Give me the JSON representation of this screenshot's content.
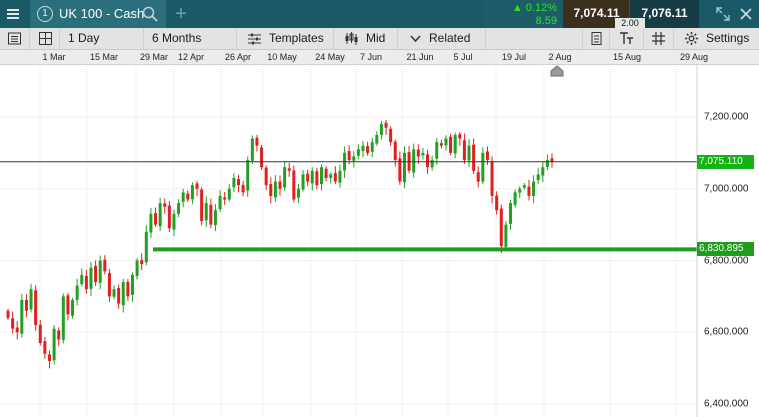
{
  "header": {
    "tab_number": "1",
    "market_title": "UK 100 - Cash",
    "add_tab": "+",
    "change_percent": "0.12%",
    "change_points": "8.59",
    "sell_price": "7,074.11",
    "buy_price": "7,076.11",
    "spread": "2.00",
    "colors": {
      "bar": "#1a5a67",
      "positive": "#2fe02f",
      "sell_bg": "#3b2f1d",
      "buy_bg": "#163c45"
    }
  },
  "toolbar": {
    "interval": "1 Day",
    "range": "6 Months",
    "templates": "Templates",
    "price_type": "Mid",
    "related": "Related",
    "settings": "Settings"
  },
  "date_axis": {
    "labels": [
      "1 Mar",
      "15 Mar",
      "29 Mar",
      "12 Apr",
      "26 Apr",
      "10 May",
      "24 May",
      "7 Jun",
      "21 Jun",
      "5 Jul",
      "19 Jul",
      "2 Aug",
      "15 Aug",
      "29 Aug"
    ]
  },
  "price_axis": {
    "labels": [
      "7,200.000",
      "7,000.000",
      "6,800.000",
      "6,600.000",
      "6,400.000"
    ],
    "current_price_label": "7,075.110",
    "support_label": "6,830.895"
  },
  "chart_data": {
    "type": "candlestick",
    "instrument": "UK 100 - Cash",
    "interval": "1 Day",
    "range": "6 Months",
    "ylim": [
      6390,
      7290
    ],
    "yticks": [
      7200,
      7000,
      6800,
      6600,
      6400
    ],
    "xticks": [
      "1 Mar",
      "15 Mar",
      "29 Mar",
      "12 Apr",
      "26 Apr",
      "10 May",
      "24 May",
      "7 Jun",
      "21 Jun",
      "5 Jul",
      "19 Jul",
      "2 Aug",
      "15 Aug",
      "29 Aug"
    ],
    "current_price": 7075.11,
    "horizontal_lines": [
      {
        "label": "6,830.895",
        "value": 6830.9,
        "color": "#1e9d1e"
      },
      {
        "label": "7,075.110",
        "value": 7075.11,
        "color": "#333333"
      }
    ],
    "up_color": "#22a022",
    "down_color": "#e02020",
    "closes": [
      6640,
      6610,
      6600,
      6690,
      6660,
      6720,
      6620,
      6570,
      6540,
      6520,
      6610,
      6580,
      6700,
      6650,
      6690,
      6730,
      6760,
      6720,
      6780,
      6740,
      6800,
      6770,
      6700,
      6720,
      6680,
      6740,
      6700,
      6760,
      6800,
      6790,
      6880,
      6930,
      6900,
      6960,
      6950,
      6890,
      6930,
      6960,
      6990,
      6970,
      7010,
      7000,
      6910,
      6960,
      6900,
      6940,
      6980,
      6970,
      7000,
      7030,
      7010,
      6990,
      7080,
      7140,
      7120,
      7060,
      7010,
      6980,
      7020,
      7000,
      7060,
      7050,
      6970,
      7000,
      7040,
      7020,
      7050,
      7010,
      7060,
      7030,
      7040,
      7020,
      7050,
      7100,
      7080,
      7090,
      7110,
      7120,
      7100,
      7130,
      7150,
      7180,
      7170,
      7130,
      7080,
      7020,
      7100,
      7050,
      7110,
      7090,
      7100,
      7060,
      7080,
      7130,
      7120,
      7140,
      7100,
      7150,
      7140,
      7080,
      7120,
      7050,
      7020,
      7100,
      7080,
      6980,
      6940,
      6840,
      6900,
      6960,
      6990,
      7000,
      7010,
      6980,
      7020,
      7040,
      7060,
      7080,
      7075
    ]
  }
}
